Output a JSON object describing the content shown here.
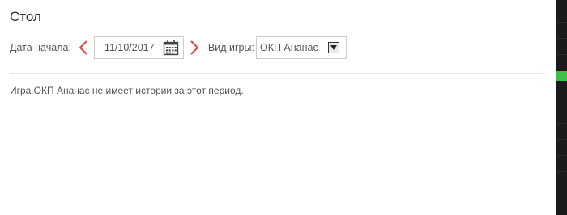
{
  "title": "Стол",
  "filters": {
    "start_date_label": "Дата начала:",
    "start_date_value": "11/10/2017",
    "game_type_label": "Вид игры:",
    "game_type_value": "ОКП Ананас"
  },
  "message": "Игра ОКП Ананас не имеет истории за этот период.",
  "icons": {
    "prev": "chevron-left-icon",
    "next": "chevron-right-icon",
    "calendar": "calendar-icon",
    "dropdown": "chevron-down-icon"
  },
  "colors": {
    "arrow": "#e0473f",
    "text": "#555555",
    "title": "#333333",
    "border": "#cccccc",
    "accent_green": "#3cc04a"
  }
}
